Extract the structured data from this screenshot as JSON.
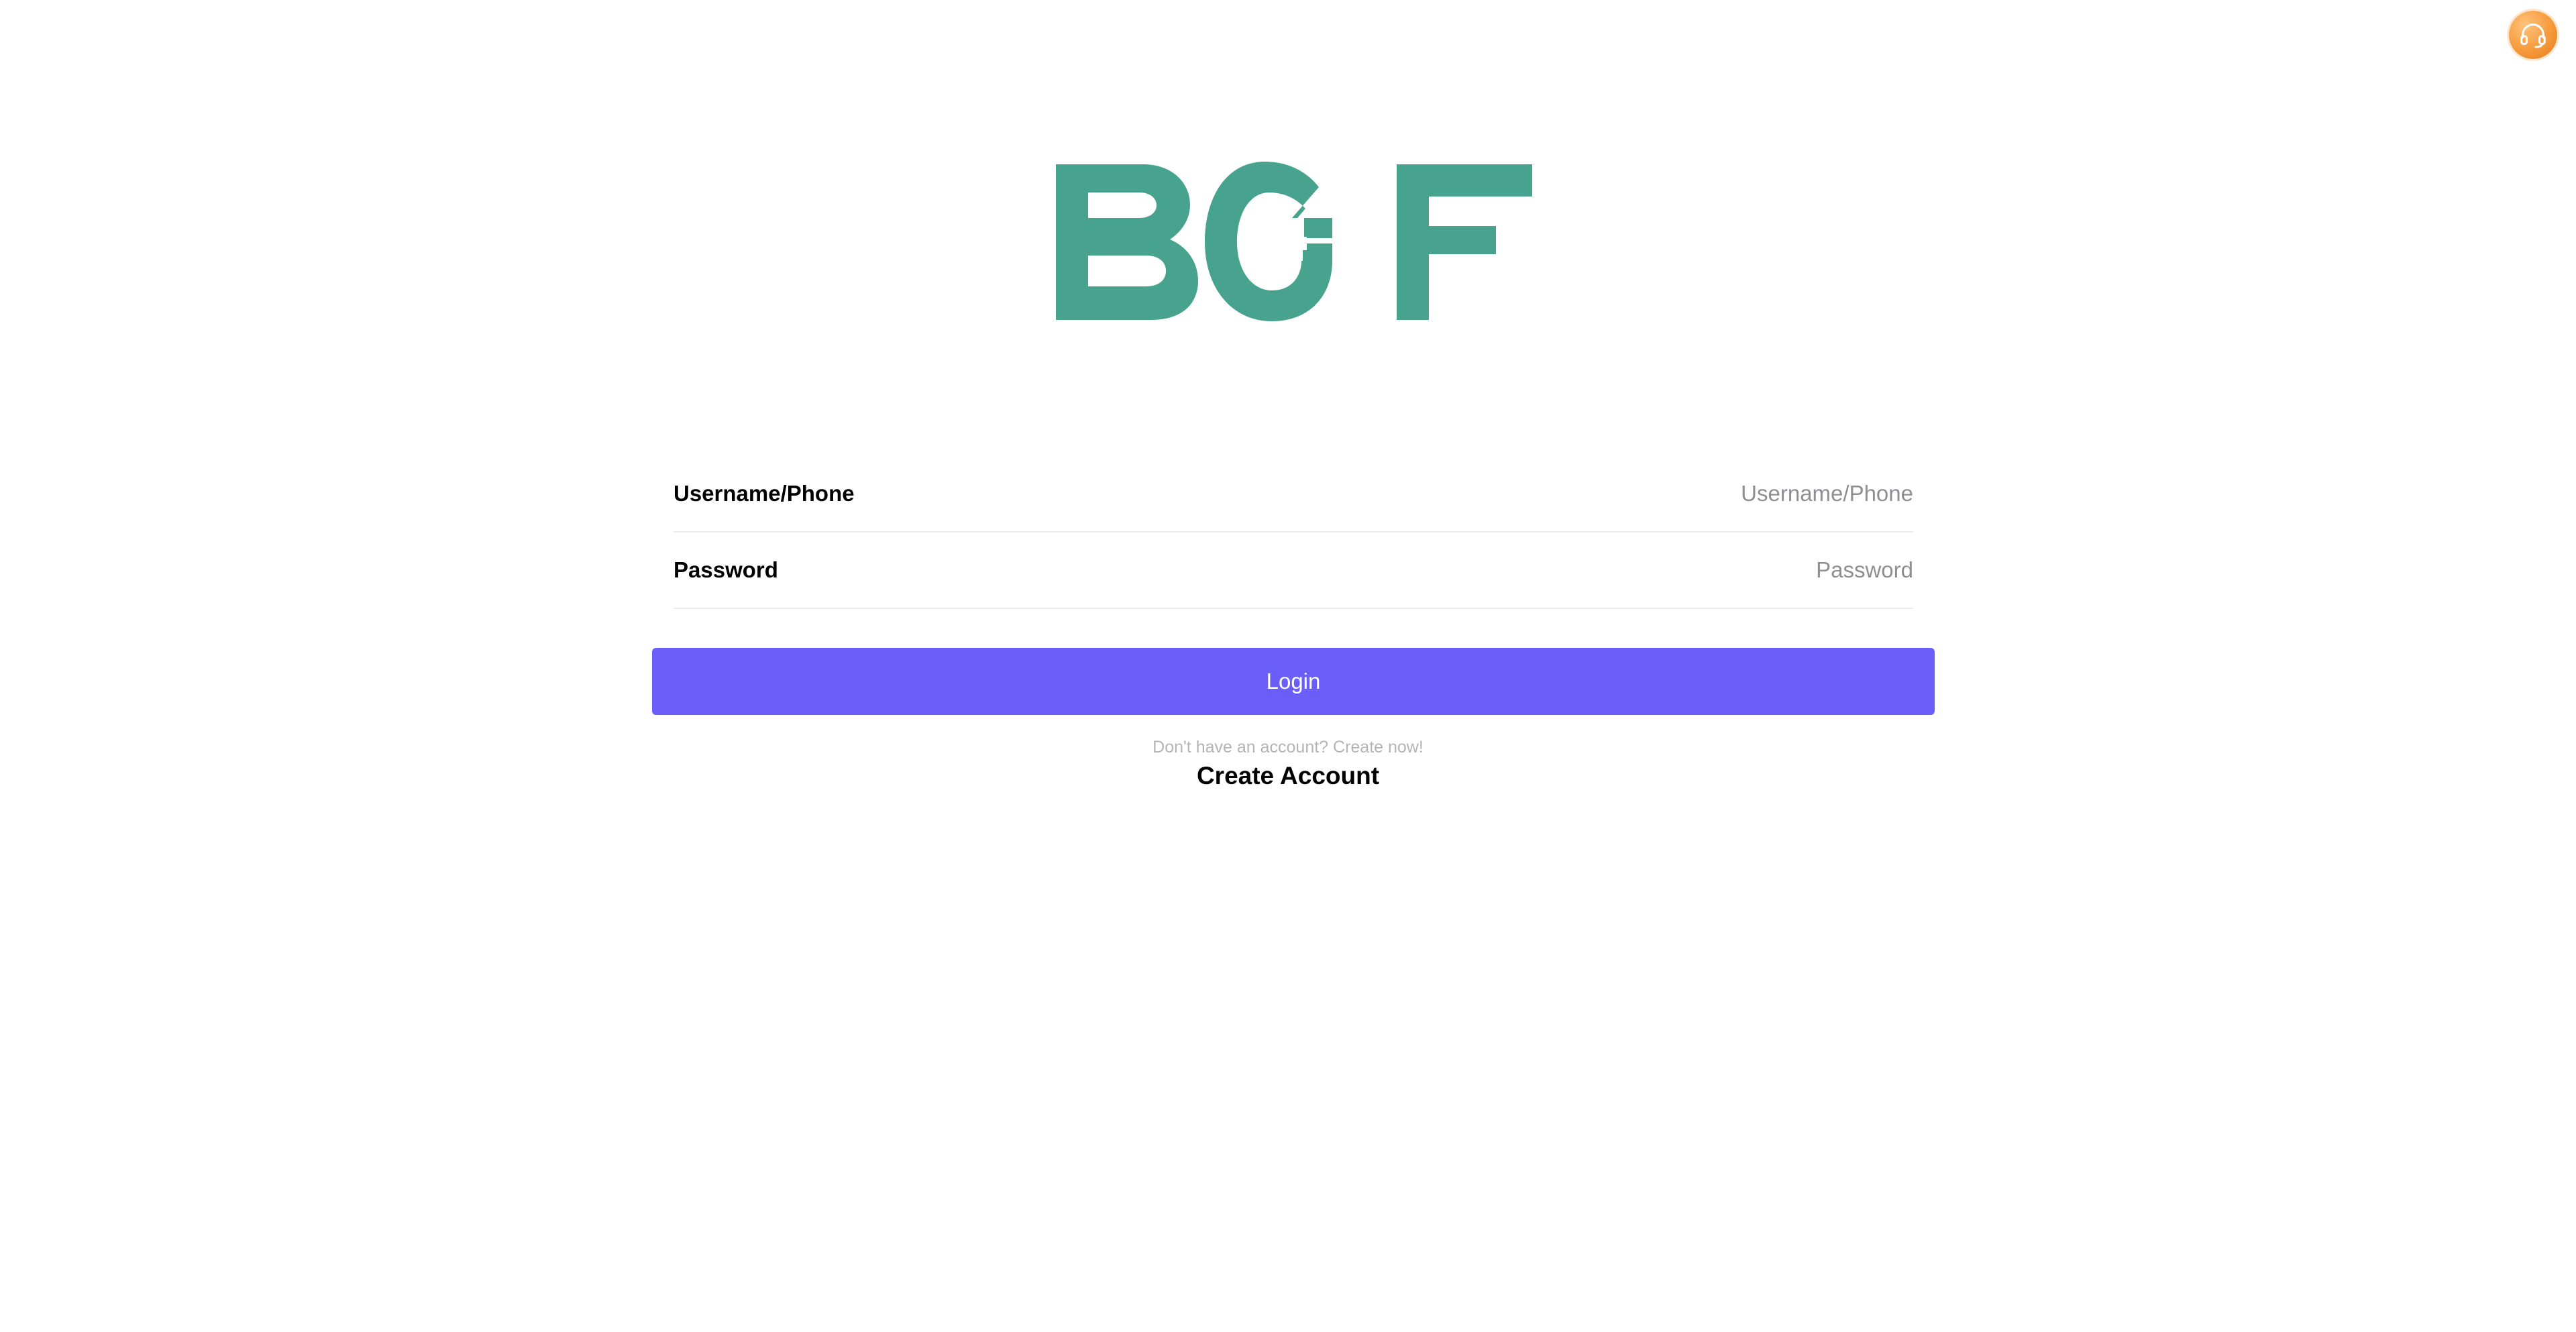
{
  "colors": {
    "brand": "#47a38e",
    "button": "#6a5df8",
    "support": "#f59a3c"
  },
  "header": {
    "support_icon": "headset-icon",
    "logo": {
      "text": "BGF"
    }
  },
  "form": {
    "username": {
      "label": "Username/Phone",
      "placeholder": "Username/Phone",
      "value": ""
    },
    "password": {
      "label": "Password",
      "placeholder": "Password",
      "value": ""
    },
    "login_label": "Login"
  },
  "footer": {
    "hint": "Don't have an account? Create now!",
    "create_account_label": "Create Account"
  }
}
